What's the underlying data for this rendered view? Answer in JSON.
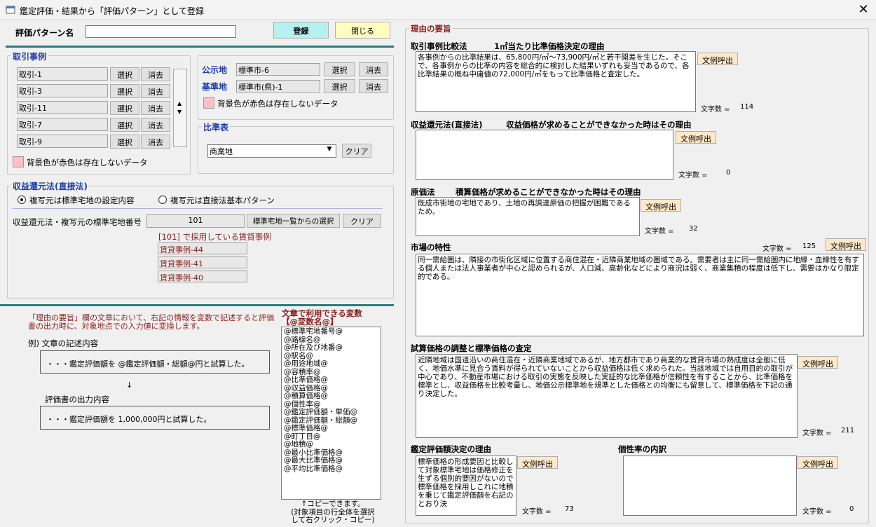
{
  "window": {
    "title": "鑑定評価・結果から「評価パターン」として登録"
  },
  "header": {
    "pattern_label": "評価パターン名",
    "pattern_value": "",
    "register": "登録",
    "close": "閉じる"
  },
  "torihiki": {
    "title": "取引事例",
    "rows": [
      {
        "value": "取引-1",
        "select": "選択",
        "clear": "消去"
      },
      {
        "value": "取引-3",
        "select": "選択",
        "clear": "消去"
      },
      {
        "value": "取引-11",
        "select": "選択",
        "clear": "消去"
      },
      {
        "value": "取引-7",
        "select": "選択",
        "clear": "消去"
      },
      {
        "value": "取引-9",
        "select": "選択",
        "clear": "消去"
      }
    ],
    "legend": "背景色が赤色は存在しないデータ"
  },
  "koji": {
    "label": "公示地",
    "value": "標準市-6",
    "select": "選択",
    "clear": "消去"
  },
  "kijun": {
    "label": "基準地",
    "value": "標準市(県)-1",
    "select": "選択",
    "clear": "消去"
  },
  "koji_legend": "背景色が赤色は存在しないデータ",
  "hijun": {
    "title": "比準表",
    "selected": "商業地",
    "clear": "クリア"
  },
  "shueki": {
    "title": "収益還元法(直接法)",
    "radio1": "複写元は標準宅地の設定内容",
    "radio2": "複写元は直接法基本パターン",
    "number_label": "収益還元法・複写元の標準宅地番号",
    "number_value": "101",
    "list_button": "標準宅地一覧からの選択",
    "clear": "クリア",
    "caption": "[101] で採用している賃貸事例",
    "cases": [
      "賃貸事例-44",
      "賃貸事例-41",
      "賃貸事例-40"
    ]
  },
  "help": {
    "note": "「理由の要旨」欄の文章において、右記の情報を変数で記述すると評価書の出力時に、対象地点での入力値に変換します。",
    "example_label": "例)  文章の記述内容",
    "example_text": "・・・鑑定評価額を  @鑑定評価額・総額@円と試算した。",
    "arrow": "↓",
    "output_label": "評価書の出力内容",
    "output_text": "・・・鑑定評価額を  1,000,000円と試算した。"
  },
  "vars": {
    "title": "文章で利用できる変数\n【@変数名@】",
    "items": [
      "@標準宅地番号@",
      "@路線名@",
      "@所在及び地番@",
      "@駅名@",
      "@用途地域@",
      "@容積率@",
      "@比準価格@",
      "@収益価格@",
      "@積算価格@",
      "@個性率@",
      "@鑑定評価額・単価@",
      "@鑑定評価額・総額@",
      "@標準価格@",
      "@町丁目@",
      "@地積@",
      "@最小比準価格@",
      "@最大比準価格@",
      "@平均比準価格@"
    ],
    "note": "↑コピーできます。\n(対象項目の行全体を選択\nして右クリック・コピー)"
  },
  "reason": {
    "title": "理由の要旨",
    "call": "文例呼出",
    "count_label": "文字数 =",
    "comp": {
      "label": "取引事例比較法",
      "sub": "1㎡当たり比準価格決定の理由",
      "text": "各事例からの比準結果は、65,800円/㎡～73,900円/㎡と若干開差を生じた。そこで、各事例からの比準の内容を総合的に検討した結果いずれも妥当であるので、各比準結果の概ね中庸値の72,000円/㎡をもって比準価格と査定した。",
      "count": "114"
    },
    "income": {
      "label": "収益還元法(直接法)",
      "sub": "収益価格が求めることができなかった時はその理由",
      "text": "",
      "count": "0"
    },
    "cost": {
      "label": "原価法",
      "sub": "積算価格が求めることができなかった時はその理由",
      "text": "既成市街地の宅地であり、土地の再調達原価の把握が困難であるため。",
      "count": "32"
    },
    "market": {
      "label": "市場の特性",
      "text": "同一需給圏は、隣接の市街化区域に位置する商住混在・近隣商業地域の圏域である。需要者は主に同一需給圏内に地縁・血縁性を有する個人または法人事業者が中心と認められるが、人口減、高齢化などにより商況は弱く、商業集積の程度は低下し、需要はかなり限定的である。",
      "count": "125"
    },
    "adjust": {
      "label": "試算価格の調整と標準価格の査定",
      "text": "近隣地域は国道沿いの商住混在・近隣商業地域であるが、地方都市であり商業的な賃貸市場の熟成度は全般に低く、地価水準に見合う賃料が得られていないことから収益価格は低く求められた。当該地域では自用目的の取引が中心であり、不動産市場における取引の実態を反映した実証的な比準価格が信頼性を有することから、比準価格を標準とし、収益価格を比較考量し、地価公示標準地を規準とした価格との均衡にも留意して、標準価格を下記の通り決定した。",
      "count": "211"
    },
    "final": {
      "label": "鑑定評価額決定の理由",
      "text": "標準価格の形成要因と比較して対象標準宅地は価格修正を生ずる個別的要因がないので標準価格を採用しこれに地積を乗じて鑑定評価額を右記のとおり決",
      "count": "73"
    },
    "indiv": {
      "label": "個性率の内訳",
      "text": "",
      "count": "0"
    }
  }
}
